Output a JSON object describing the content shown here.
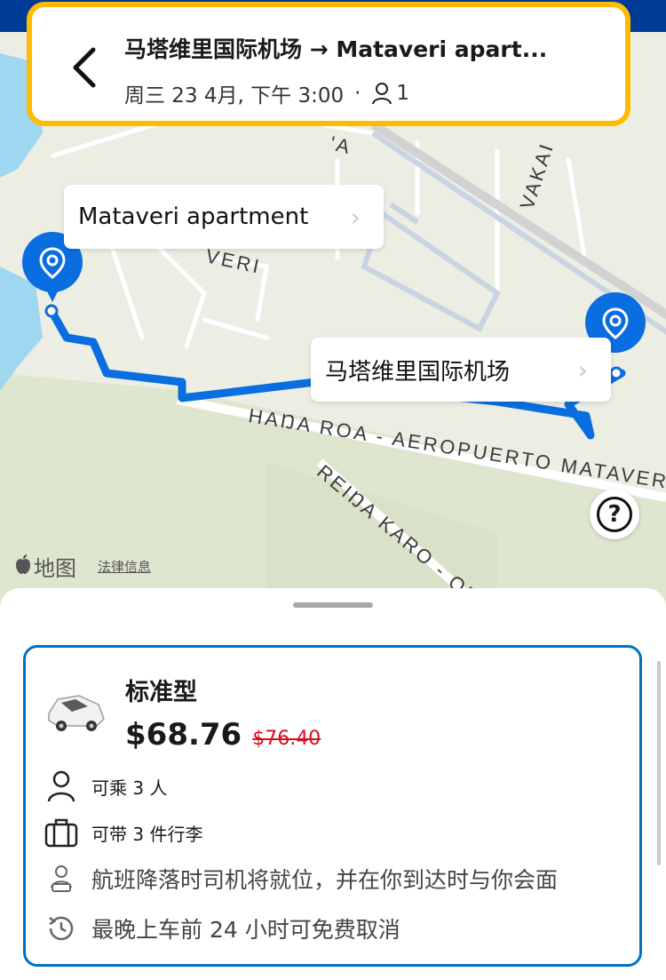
{
  "header": {
    "title": "马塔维里国际机场 → Mataveri apart...",
    "date_time": "周三 23 4月, 下午 3:00",
    "separator": "·",
    "passengers": "1"
  },
  "map": {
    "roads": {
      "hana_roa": "HAŊA ROA - AEROPUERTO MATAVERI",
      "reina_karo": "REIŊA KARO - ORO",
      "vakai": "VAKAI",
      "veri": "VERI",
      "a_fragment": "'A"
    },
    "destination_label": "Mataveri apartment",
    "origin_label": "马塔维里国际机场",
    "brand": "地图",
    "legal": "法律信息",
    "help": "?"
  },
  "vehicle": {
    "name": "标准型",
    "price": "$68.76",
    "original_price": "$76.40",
    "features": [
      {
        "icon": "person-icon",
        "text": "可乘 3 人"
      },
      {
        "icon": "luggage-icon",
        "text": "可带 3 件行李"
      },
      {
        "icon": "driver-icon",
        "text": "航班降落时司机将就位，并在你到达时与你会面"
      },
      {
        "icon": "clock-history-icon",
        "text": "最晚上车前 24 小时可免费取消"
      }
    ]
  },
  "colors": {
    "brand_blue": "#003b95",
    "accent_yellow": "#febb02",
    "route_blue": "#0a6de0",
    "card_border": "#0071c2",
    "strike_red": "#d4111e"
  }
}
